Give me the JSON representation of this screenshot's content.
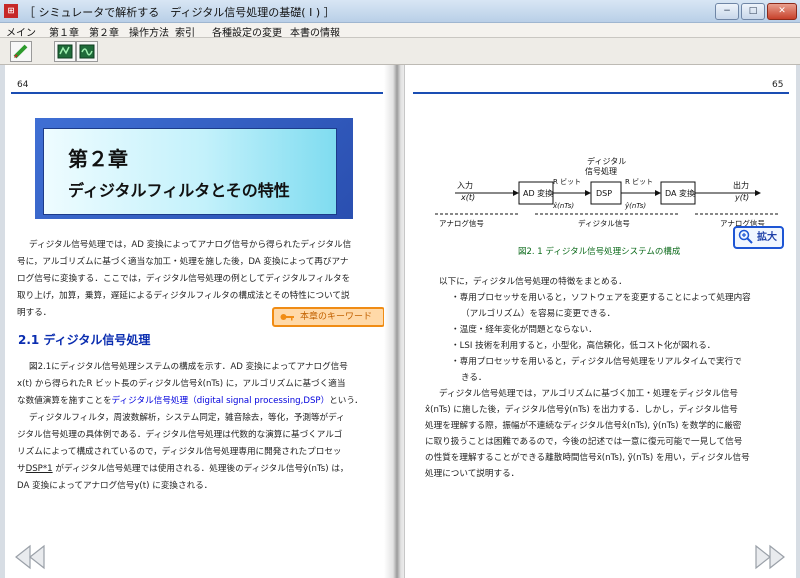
{
  "window": {
    "app_icon": "app-logo-icon",
    "title": "［ シミュレータで解析する　ディジタル信号処理の基礎( I ) ］",
    "controls": {
      "minimize": "−",
      "maximize": "□",
      "close": "✕"
    }
  },
  "menu": [
    "メイン",
    "第１章",
    "第２章",
    "操作方法",
    "索引",
    "各種設定の変更",
    "本書の情報"
  ],
  "toolbar": {
    "buttons": [
      "pencil-icon",
      "chip-icon",
      "monitor-icon"
    ]
  },
  "left_page": {
    "page_number": "64",
    "chapter_number": "第２章",
    "chapter_title": "ディジタルフィルタとその特性",
    "intro": [
      "ディジタル信号処理では，AD 変換によってアナログ信号から得られたディジタル信",
      "号に，アルゴリズムに基づく適当な加工・処理を施した後，DA 変換によって再びアナ",
      "ログ信号に変換する．ここでは，ディジタル信号処理の例としてディジタルフィルタを",
      "取り上げ，加算，乗算，遅延によるディジタルフィルタの構成法とその特性について説",
      "明する．"
    ],
    "keyword_button": "本章のキーワード",
    "section_title": "2.1  ディジタル信号処理",
    "body": [
      "図2.1にディジタル信号処理システムの構成を示す．AD 変換によってアナログ信号",
      "x(t) から得られたR ビット長のディジタル信号x̂(nTs) に，アルゴリズムに基づく適当",
      "な数値演算を施すことを",
      "ディジタル信号処理（digital signal processing,DSP）",
      "という．",
      "ディジタルフィルタ，周波数解析，システム同定，雑音除去，等化，予測等がディ",
      "ジタル信号処理の具体例である．ディジタル信号処理は代数的な演算に基づくアルゴ",
      "リズムによって構成されているので，ディジタル信号処理専用に開発されたプロセッ",
      "サ",
      "DSP*1",
      " がディジタル信号処理では使用される．処理後のディジタル信号ŷ(nTs) は，",
      "DA 変換によってアナログ信号y(t) に変換される．"
    ]
  },
  "right_page": {
    "page_number": "65",
    "diagram": {
      "dsp_label": "ディジタル\n信号処理",
      "input": "入力",
      "input_signal": "x(t)",
      "ad": "AD 変換",
      "bits1": "R ビット",
      "xhat": "x̂(nTs)",
      "dsp": "DSP",
      "bits2": "R ビット",
      "yhat": "ŷ(nTs)",
      "da": "DA 変換",
      "output": "出力",
      "output_signal": "y(t)",
      "analog_left": "アナログ信号",
      "digital": "ディジタル信号",
      "analog_right": "アナログ信号"
    },
    "caption": "図2. 1  ディジタル信号処理システムの構成",
    "zoom_button": "拡大",
    "body": [
      "以下に，ディジタル信号処理の特徴をまとめる．",
      "・専用プロセッサを用いると，ソフトウェアを変更することによって処理内容",
      "（アルゴリズム）を容易に変更できる．",
      "・温度・経年変化が問題とならない．",
      "・LSI 技術を利用すると，小型化，高信頼化，低コスト化が図れる．",
      "・専用プロセッサを用いると，ディジタル信号処理をリアルタイムで実行で",
      "きる．",
      "ディジタル信号処理では，アルゴリズムに基づく加工・処理をディジタル信号",
      "x̂(nTs) に施した後，ディジタル信号ŷ(nTs) を出力する．しかし，ディジタル信号",
      "処理を理解する際，振幅が不連続なディジタル信号x̂(nTs), ŷ(nTs) を数学的に厳密",
      "に取り扱うことは困難であるので，今後の記述では一意に復元可能で一見して信号",
      "の性質を理解することができる離散時間信号x̃(nTs), ỹ(nTs) を用い，ディジタル信号",
      "処理について説明する．"
    ]
  },
  "navigation": {
    "prev_icon": "double-left-arrow-icon",
    "next_icon": "double-right-arrow-icon"
  },
  "colors": {
    "accent": "#1a4db3",
    "link": "#0000dd",
    "keyword_border": "#f08c14",
    "caption": "#0b6a1a"
  }
}
